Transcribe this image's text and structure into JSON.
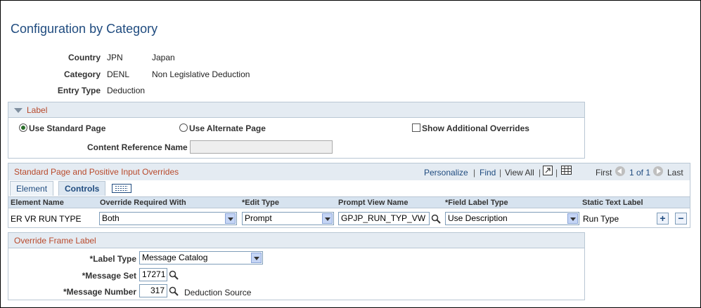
{
  "page": {
    "title": "Configuration by Category"
  },
  "header_fields": {
    "country_label": "Country",
    "country_code": "JPN",
    "country_name": "Japan",
    "category_label": "Category",
    "category_code": "DENL",
    "category_name": "Non Legislative Deduction",
    "entry_type_label": "Entry Type",
    "entry_type_value": "Deduction"
  },
  "label_group": {
    "header": "Label",
    "use_standard_page": "Use Standard Page",
    "use_alternate_page": "Use Alternate Page",
    "show_additional_overrides": "Show Additional Overrides",
    "content_reference_label": "Content Reference Name",
    "content_reference_value": ""
  },
  "overrides_grid": {
    "header": "Standard Page and Positive Input Overrides",
    "personalize": "Personalize",
    "find": "Find",
    "view_all": "View All",
    "first": "First",
    "range": "1 of 1",
    "last": "Last",
    "tabs": [
      "Element",
      "Controls"
    ],
    "columns": [
      "Element Name",
      "Override Required With",
      "*Edit Type",
      "Prompt View Name",
      "*Field Label Type",
      "Static Text Label"
    ],
    "row": {
      "element_name": "ER VR RUN TYPE",
      "override_required_with": "Both",
      "edit_type": "Prompt",
      "prompt_view_name": "GPJP_RUN_TYP_VW",
      "field_label_type": "Use Description",
      "static_text_label": "Run Type"
    },
    "add_symbol": "+",
    "remove_symbol": "−"
  },
  "override_frame": {
    "header": "Override Frame Label",
    "label_type_label": "*Label Type",
    "label_type_value": "Message Catalog",
    "message_set_label": "*Message Set",
    "message_set_value": "17271",
    "message_number_label": "*Message Number",
    "message_number_value": "317",
    "message_description": "Deduction Source"
  },
  "icons": {
    "collapse": "collapse-triangle-icon",
    "lookup": "magnifier-icon",
    "zoom": "zoom-icon",
    "grid": "grid-download-icon"
  },
  "colors": {
    "title": "#1f4b7f",
    "group_header_text": "#b8492b",
    "group_header_bg": "#e4ebf2"
  }
}
